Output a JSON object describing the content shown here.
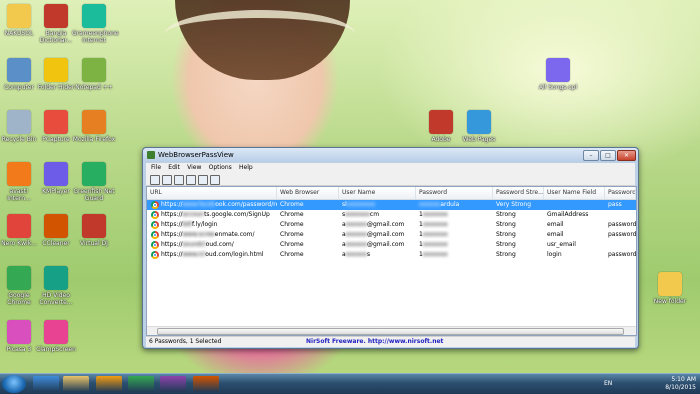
{
  "desktop": {
    "icons_left": [
      {
        "label": "NAKUSOL",
        "icon": "folder-icon",
        "color": "#f2c94c"
      },
      {
        "label": "Computer",
        "icon": "computer-icon",
        "color": "#5b8fc7"
      },
      {
        "label": "Recycle Bin",
        "icon": "recycle-bin-icon",
        "color": "#9fb4c8"
      },
      {
        "label": "avast! Intern...",
        "icon": "avast-icon",
        "color": "#f27a1a"
      },
      {
        "label": "Nero Kwik...",
        "icon": "nero-icon",
        "color": "#e0443a"
      },
      {
        "label": "Google Chrome",
        "icon": "chrome-icon",
        "color": "#34a853"
      },
      {
        "label": "Picasa 3",
        "icon": "picasa-icon",
        "color": "#d94fbd"
      }
    ],
    "icons_col2": [
      {
        "label": "Bangla Dictionar...",
        "icon": "dictionary-icon",
        "color": "#c0392b"
      },
      {
        "label": "Folder Hider",
        "icon": "lock-icon",
        "color": "#f1c40f"
      },
      {
        "label": "PCapture",
        "icon": "pcapture-icon",
        "color": "#e74c3c"
      },
      {
        "label": "KMPlayer",
        "icon": "kmplayer-icon",
        "color": "#6c5ce7"
      },
      {
        "label": "CCleaner",
        "icon": "ccleaner-icon",
        "color": "#d35400"
      },
      {
        "label": "HD Video Converte...",
        "icon": "video-converter-icon",
        "color": "#16a085"
      },
      {
        "label": "ClampScreen",
        "icon": "camera-icon",
        "color": "#e84393"
      }
    ],
    "icons_col3": [
      {
        "label": "Grameenphone Internet",
        "icon": "modem-icon",
        "color": "#1abc9c"
      },
      {
        "label": "Notepad ++",
        "icon": "notepad-icon",
        "color": "#7cb342"
      },
      {
        "label": "Mozilla Firefox",
        "icon": "firefox-icon",
        "color": "#e67e22"
      },
      {
        "label": "Greenfish Net Guard",
        "icon": "netguard-icon",
        "color": "#27ae60"
      },
      {
        "label": "Virtual DJ",
        "icon": "virtualdj-icon",
        "color": "#c0392b"
      }
    ],
    "icons_right": [
      {
        "label": "All Songs.cpl",
        "icon": "media-icon",
        "color": "#7b68ee"
      },
      {
        "label": "Adobe",
        "icon": "adobe-icon",
        "color": "#c0392b"
      },
      {
        "label": "Web Pages",
        "icon": "web-pages-icon",
        "color": "#3498db"
      },
      {
        "label": "New folder",
        "icon": "folder-icon",
        "color": "#f2c94c"
      }
    ]
  },
  "window": {
    "title": "WebBrowserPassView",
    "menu": [
      "File",
      "Edit",
      "View",
      "Options",
      "Help"
    ],
    "controls": {
      "minimize": "–",
      "maximize": "□",
      "close": "✕"
    },
    "columns": [
      "URL",
      "Web Browser",
      "User Name",
      "Password",
      "Password Stre...",
      "User Name Field",
      "Password F..."
    ],
    "rows": [
      {
        "url": "https://",
        "url_blur": "www.faceb",
        "url_tail": "ook.com/password/reauth/",
        "browser": "Chrome",
        "user": "sl",
        "user_blur": "xxxxxxxx",
        "user_tail": "",
        "password": "",
        "pw_blur": "xxxxxx",
        "pw_tail": "ardula",
        "strength": "Very Strong",
        "user_field": "",
        "pw_field": "pass",
        "selected": true
      },
      {
        "url": "https://",
        "url_blur": "accoun",
        "url_tail": "ts.google.com/SignUp",
        "browser": "Chrome",
        "user": "s",
        "user_blur": "xxxxxxx",
        "user_tail": "cm",
        "password": "1",
        "pw_blur": "xxxxxxx",
        "pw_tail": "",
        "strength": "Strong",
        "user_field": "GmailAddress",
        "pw_field": "",
        "selected": false
      },
      {
        "url": "https://",
        "url_blur": "bitl",
        "url_tail": "f.ly/login",
        "browser": "Chrome",
        "user": "a",
        "user_blur": "xxxxxx",
        "user_tail": "@gmail.com",
        "password": "1",
        "pw_blur": "xxxxxxx",
        "pw_tail": "",
        "strength": "Strong",
        "user_field": "email",
        "pw_field": "password",
        "selected": false
      },
      {
        "url": "https://",
        "url_blur": "www.scree",
        "url_tail": "enmate.com/",
        "browser": "Chrome",
        "user": "a",
        "user_blur": "xxxxxx",
        "user_tail": "@gmail.com",
        "password": "1",
        "pw_blur": "xxxxxxx",
        "pw_tail": "",
        "strength": "Strong",
        "user_field": "email",
        "pw_field": "password",
        "selected": false
      },
      {
        "url": "https://",
        "url_blur": "soundcl",
        "url_tail": "oud.com/",
        "browser": "Chrome",
        "user": "a",
        "user_blur": "xxxxxx",
        "user_tail": "@gmail.com",
        "password": "1",
        "pw_blur": "xxxxxxx",
        "pw_tail": "",
        "strength": "Strong",
        "user_field": "usr_email",
        "pw_field": "",
        "selected": false
      },
      {
        "url": "https://",
        "url_blur": "www.icl",
        "url_tail": "oud.com/login.html",
        "browser": "Chrome",
        "user": "a",
        "user_blur": "xxxxxx",
        "user_tail": "s",
        "password": "1",
        "pw_blur": "xxxxxxx",
        "pw_tail": "",
        "strength": "Strong",
        "user_field": "login",
        "pw_field": "password",
        "selected": false
      }
    ],
    "status": {
      "count": "6 Passwords, 1 Selected",
      "link": "NirSoft Freeware.  http://www.nirsoft.net"
    }
  },
  "taskbar": {
    "language": "EN",
    "time": "5:10 AM",
    "date": "8/10/2015",
    "pinned": [
      {
        "icon": "internet-explorer-icon",
        "color": "#3f8ddb"
      },
      {
        "icon": "file-explorer-icon",
        "color": "#e9c46a"
      },
      {
        "icon": "media-player-icon",
        "color": "#f39c12"
      },
      {
        "icon": "chrome-icon",
        "color": "#34a853"
      },
      {
        "icon": "winrar-icon",
        "color": "#8e44ad"
      },
      {
        "icon": "webbrowserpassview-icon",
        "color": "#d35400"
      }
    ]
  }
}
